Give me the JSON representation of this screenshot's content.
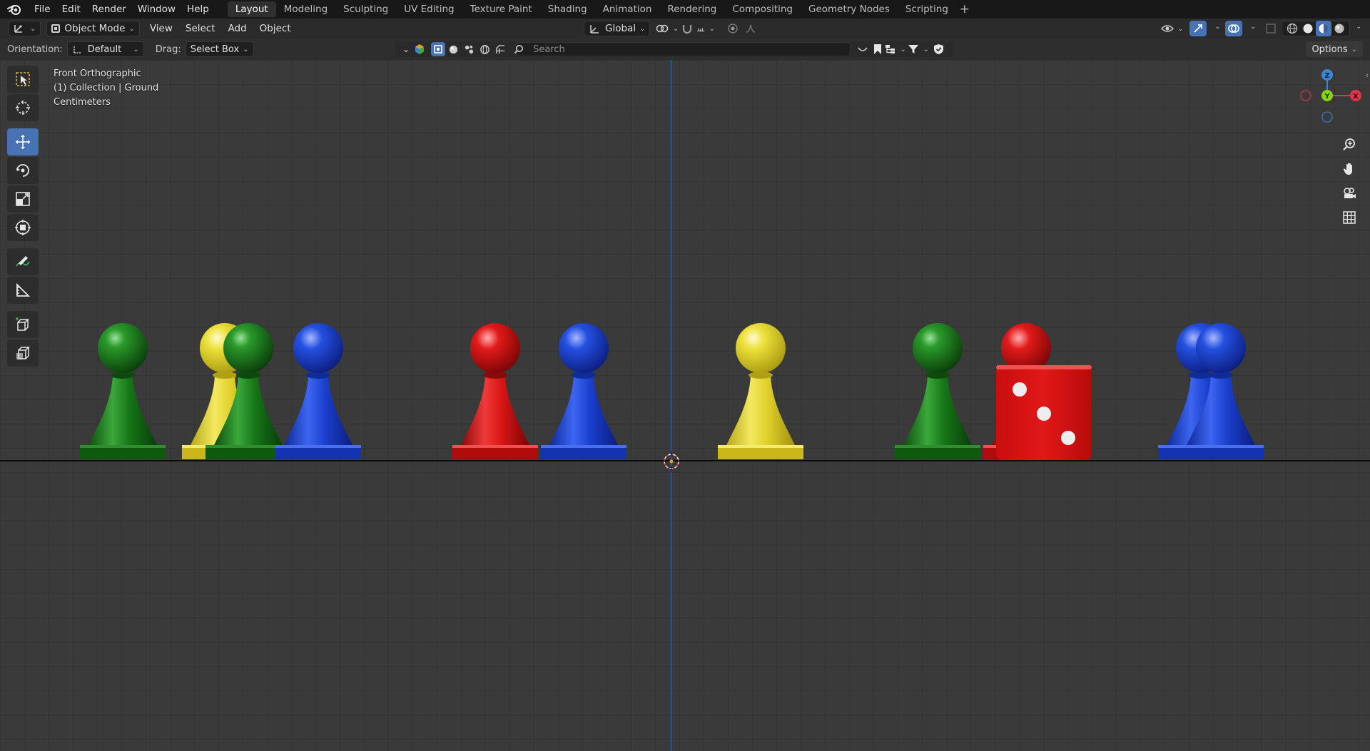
{
  "menu": {
    "items": [
      "File",
      "Edit",
      "Render",
      "Window",
      "Help"
    ]
  },
  "workspaces": {
    "tabs": [
      "Layout",
      "Modeling",
      "Sculpting",
      "UV Editing",
      "Texture Paint",
      "Shading",
      "Animation",
      "Rendering",
      "Compositing",
      "Geometry Nodes",
      "Scripting"
    ],
    "active": "Layout",
    "add_symbol": "+"
  },
  "header": {
    "mode_label": "Object Mode",
    "view_menus": [
      "View",
      "Select",
      "Add",
      "Object"
    ],
    "transform_orientation": "Global"
  },
  "tool_settings": {
    "orientation_label": "Orientation:",
    "orientation_value": "Default",
    "drag_label": "Drag:",
    "drag_value": "Select Box",
    "options_label": "Options"
  },
  "search": {
    "placeholder": "Search"
  },
  "viewport": {
    "view_name": "Front Orthographic",
    "collection_info": "(1) Collection | Ground",
    "units": "Centimeters",
    "gizmo_axes": {
      "z": "Z",
      "y": "Y",
      "x": "X"
    }
  },
  "colors": {
    "accent": "#4772b3",
    "green_piece": "#1e7a1e",
    "yellow_piece": "#e3d22a",
    "blue_piece": "#1a3fcc",
    "red_piece": "#d81414",
    "axis_x": "#e0354a",
    "axis_y": "#8ad11a",
    "axis_z": "#3a86d6"
  },
  "scene": {
    "pieces": [
      "green",
      "yellow",
      "green",
      "blue",
      "red",
      "blue",
      "yellow",
      "green",
      "red",
      "blue",
      "blue"
    ],
    "die_face_value": 3
  },
  "icons": {
    "toolbar": [
      "select-box-icon",
      "cursor-icon",
      "move-icon",
      "rotate-icon",
      "scale-icon",
      "transform-icon",
      "annotate-icon",
      "measure-icon",
      "add-cube-icon",
      "add-object-icon"
    ],
    "nav": [
      "zoom-icon",
      "pan-hand-icon",
      "camera-icon",
      "ortho-grid-icon"
    ]
  }
}
